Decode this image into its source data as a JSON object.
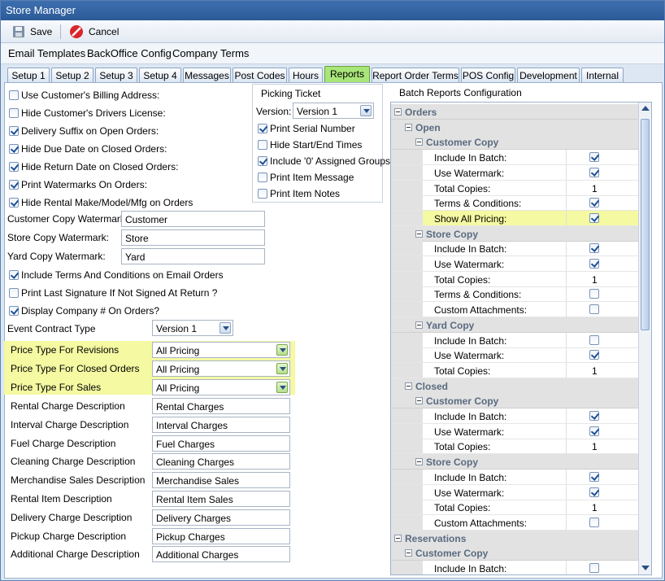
{
  "window": {
    "title": "Store Manager"
  },
  "toolbar": {
    "save_label": "Save",
    "cancel_label": "Cancel"
  },
  "menu": [
    "Email Templates",
    "BackOffice Config",
    "Company Terms"
  ],
  "tabs": [
    "Setup 1",
    "Setup 2",
    "Setup 3",
    "Setup 4",
    "Messages",
    "Post Codes",
    "Hours",
    "Reports",
    "Report Order Terms",
    "POS Config",
    "Development",
    "Internal"
  ],
  "active_tab": "Reports",
  "checks": [
    {
      "label": "Use Customer's Billing Address:",
      "checked": false
    },
    {
      "label": "Hide Customer's Drivers License:",
      "checked": false
    },
    {
      "label": "Delivery Suffix on Open Orders:",
      "checked": true
    },
    {
      "label": "Hide Due Date on Closed Orders:",
      "checked": true
    },
    {
      "label": "Hide Return Date on Closed Orders:",
      "checked": true
    },
    {
      "label": "Print Watermarks On Orders:",
      "checked": true
    },
    {
      "label": "Hide Rental Make/Model/Mfg on Orders",
      "checked": true
    }
  ],
  "watermarks": [
    {
      "label": "Customer Copy Watermark:",
      "value": "Customer"
    },
    {
      "label": "Store Copy Watermark:",
      "value": "Store"
    },
    {
      "label": "Yard Copy Watermark:",
      "value": "Yard"
    }
  ],
  "checks2": [
    {
      "label": "Include Terms And Conditions on Email Orders",
      "checked": true
    },
    {
      "label": "Print Last Signature If Not Signed At Return ?",
      "checked": false
    },
    {
      "label": "Display Company # On Orders?",
      "checked": true
    }
  ],
  "event_contract": {
    "label": "Event Contract Type",
    "value": "Version 1"
  },
  "price_types": [
    {
      "label": "Price Type For Revisions",
      "value": "All Pricing"
    },
    {
      "label": "Price Type For Closed Orders",
      "value": "All Pricing"
    },
    {
      "label": "Price Type For Sales",
      "value": "All Pricing"
    }
  ],
  "descriptions": [
    {
      "label": "Rental Charge Description",
      "value": "Rental Charges"
    },
    {
      "label": "Interval Charge Description",
      "value": "Interval Charges"
    },
    {
      "label": "Fuel Charge Description",
      "value": "Fuel Charges"
    },
    {
      "label": "Cleaning Charge Description",
      "value": "Cleaning Charges"
    },
    {
      "label": "Merchandise Sales Description",
      "value": "Merchandise Sales"
    },
    {
      "label": "Rental Item Description",
      "value": "Rental Item Sales"
    },
    {
      "label": "Delivery Charge Description",
      "value": "Delivery Charges"
    },
    {
      "label": "Pickup Charge Description",
      "value": "Pickup Charges"
    },
    {
      "label": "Additional Charge Description",
      "value": "Additional Charges"
    }
  ],
  "picking": {
    "title": "Picking Ticket",
    "version_label": "Version:",
    "version_value": "Version 1",
    "items": [
      {
        "label": "Print Serial Number",
        "checked": true
      },
      {
        "label": "Hide Start/End Times",
        "checked": false
      },
      {
        "label": "Include '0' Assigned Groups",
        "checked": true
      },
      {
        "label": "Print Item Message",
        "checked": false
      },
      {
        "label": "Print Item Notes",
        "checked": false
      }
    ]
  },
  "batch": {
    "title": "Batch Reports Configuration",
    "rows": [
      {
        "kind": "cat",
        "level": 0,
        "label": "Orders"
      },
      {
        "kind": "cat",
        "level": 1,
        "label": "Open"
      },
      {
        "kind": "cat",
        "level": 2,
        "label": "Customer Copy"
      },
      {
        "kind": "bool",
        "label": "Include In Batch:",
        "checked": true
      },
      {
        "kind": "bool",
        "label": "Use Watermark:",
        "checked": true
      },
      {
        "kind": "num",
        "label": "Total Copies:",
        "value": "1"
      },
      {
        "kind": "bool",
        "label": "Terms & Conditions:",
        "checked": true
      },
      {
        "kind": "bool",
        "label": "Show All Pricing:",
        "checked": true,
        "highlight": true
      },
      {
        "kind": "cat",
        "level": 2,
        "label": "Store Copy"
      },
      {
        "kind": "bool",
        "label": "Include In Batch:",
        "checked": true
      },
      {
        "kind": "bool",
        "label": "Use Watermark:",
        "checked": true
      },
      {
        "kind": "num",
        "label": "Total Copies:",
        "value": "1"
      },
      {
        "kind": "bool",
        "label": "Terms & Conditions:",
        "checked": false
      },
      {
        "kind": "bool",
        "label": "Custom Attachments:",
        "checked": false
      },
      {
        "kind": "cat",
        "level": 2,
        "label": "Yard Copy"
      },
      {
        "kind": "bool",
        "label": "Include In Batch:",
        "checked": false
      },
      {
        "kind": "bool",
        "label": "Use Watermark:",
        "checked": true
      },
      {
        "kind": "num",
        "label": "Total Copies:",
        "value": "1"
      },
      {
        "kind": "cat",
        "level": 1,
        "label": "Closed"
      },
      {
        "kind": "cat",
        "level": 2,
        "label": "Customer Copy"
      },
      {
        "kind": "bool",
        "label": "Include In Batch:",
        "checked": true
      },
      {
        "kind": "bool",
        "label": "Use Watermark:",
        "checked": true
      },
      {
        "kind": "num",
        "label": "Total Copies:",
        "value": "1"
      },
      {
        "kind": "cat",
        "level": 2,
        "label": "Store Copy"
      },
      {
        "kind": "bool",
        "label": "Include In Batch:",
        "checked": true
      },
      {
        "kind": "bool",
        "label": "Use Watermark:",
        "checked": true
      },
      {
        "kind": "num",
        "label": "Total Copies:",
        "value": "1"
      },
      {
        "kind": "bool",
        "label": "Custom Attachments:",
        "checked": false
      },
      {
        "kind": "cat",
        "level": 0,
        "label": "Reservations"
      },
      {
        "kind": "cat",
        "level": 1,
        "label": "Customer Copy"
      },
      {
        "kind": "bool",
        "label": "Include In Batch:",
        "checked": false
      }
    ]
  },
  "colors": {
    "highlight": "#f4f9a2",
    "active_tab": "#a9e67a",
    "title_bar": "#2c5a98"
  }
}
